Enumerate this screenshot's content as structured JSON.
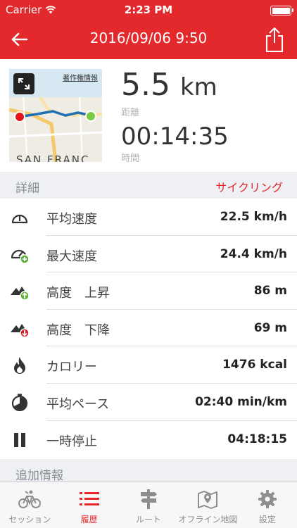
{
  "status_bar": {
    "carrier": "Carrier",
    "time": "2:23 PM"
  },
  "nav": {
    "title": "2016/09/06 9:50"
  },
  "map": {
    "copyright": "著作権情報",
    "city": "SAN FRANC"
  },
  "summary": {
    "distance_value": "5.5",
    "distance_unit": "km",
    "distance_label": "距離",
    "time_value": "00:14:35",
    "time_label": "時間"
  },
  "details": {
    "title": "詳細",
    "activity": "サイクリング",
    "rows": [
      {
        "icon": "speedometer-icon",
        "label": "平均速度",
        "value": "22.5 km/h"
      },
      {
        "icon": "max-speed-icon",
        "label": "最大速度",
        "value": "24.4 km/h"
      },
      {
        "icon": "elevation-up-icon",
        "label": "高度　上昇",
        "value": "86 m"
      },
      {
        "icon": "elevation-down-icon",
        "label": "高度　下降",
        "value": "69 m"
      },
      {
        "icon": "flame-icon",
        "label": "カロリー",
        "value": "1476 kcal"
      },
      {
        "icon": "pace-icon",
        "label": "平均ペース",
        "value": "02:40 min/km"
      },
      {
        "icon": "pause-icon",
        "label": "一時停止",
        "value": "04:18:15"
      }
    ]
  },
  "extra": {
    "title": "追加情報"
  },
  "tabs": [
    {
      "icon": "cycling-session-icon",
      "label": "セッション",
      "active": false
    },
    {
      "icon": "list-icon",
      "label": "履歴",
      "active": true
    },
    {
      "icon": "signpost-icon",
      "label": "ルート",
      "active": false
    },
    {
      "icon": "map-icon",
      "label": "オフライン地図",
      "active": false
    },
    {
      "icon": "gear-icon",
      "label": "設定",
      "active": false
    }
  ],
  "colors": {
    "brand": "#e4292c",
    "start_marker": "#e0151b",
    "end_marker": "#7ac943",
    "route": "#1f6fb5",
    "up_badge": "#5cb032",
    "down_badge": "#d9232d"
  }
}
